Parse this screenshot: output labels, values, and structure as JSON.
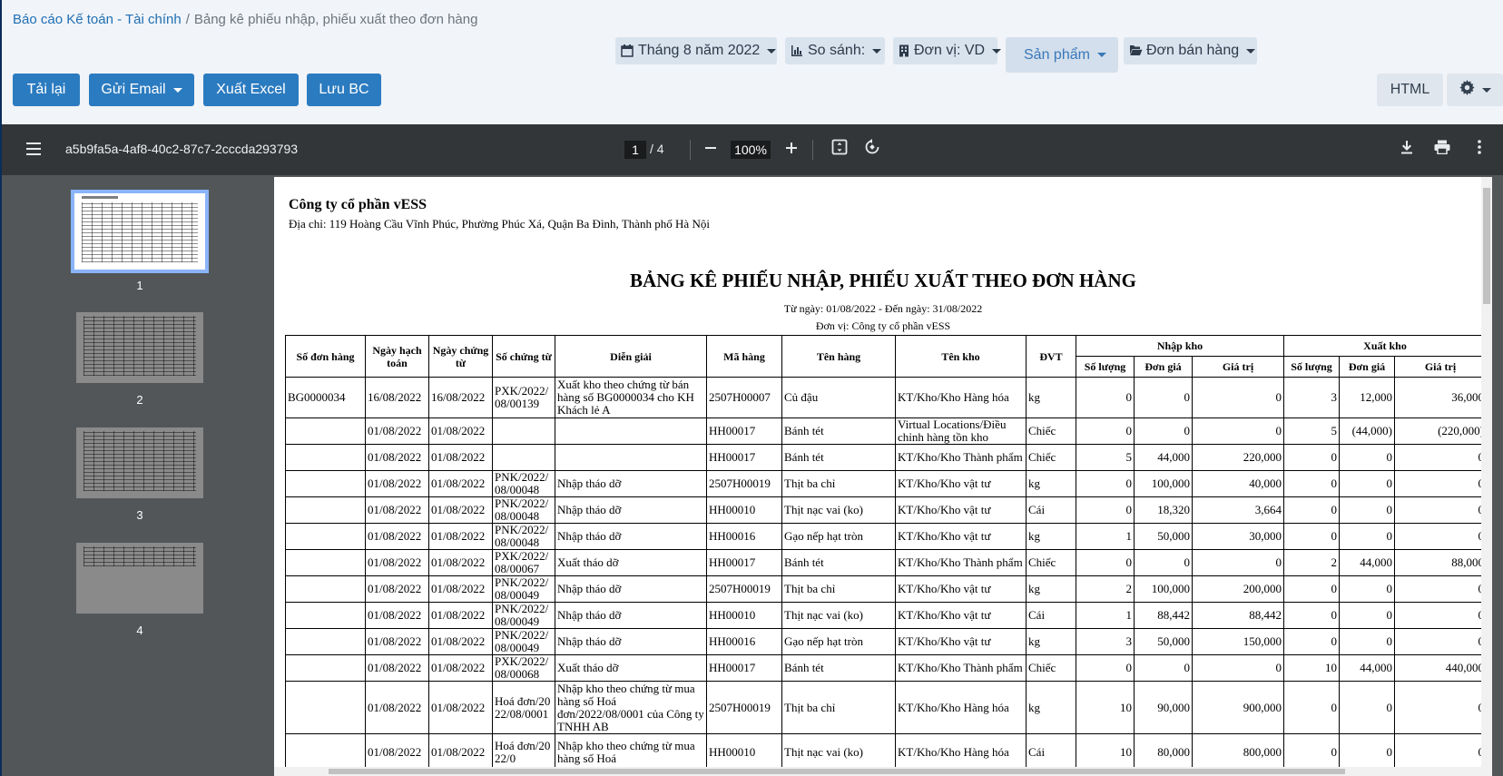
{
  "breadcrumb": {
    "parent": "Báo cáo Kế toán - Tài chính",
    "separator": "/",
    "current": "Bảng kê phiếu nhập, phiếu xuất theo đơn hàng"
  },
  "filters": {
    "period": "Tháng 8 năm 2022",
    "compare": "So sánh:",
    "unit": "Đơn vị: VD",
    "product": "Sản phẩm",
    "order_type": "Đơn bán hàng"
  },
  "toolbar": {
    "reload": "Tải lại",
    "email": "Gửi Email",
    "excel": "Xuất Excel",
    "save": "Lưu BC",
    "html": "HTML"
  },
  "viewer": {
    "doc_title": "a5b9fa5a-4af8-40c2-87c7-2cccda293793",
    "page_current": "1",
    "page_total": "/ 4",
    "zoom": "100%",
    "thumbnails": [
      "1",
      "2",
      "3",
      "4"
    ]
  },
  "report": {
    "company": "Công ty cổ phần vESS",
    "address": "Địa chỉ: 119 Hoàng Cầu Vĩnh Phúc, Phường Phúc Xá, Quận Ba Đình, Thành phố Hà Nội",
    "title": "BẢNG KÊ PHIẾU NHẬP, PHIẾU XUẤT THEO ĐƠN HÀNG",
    "date_range": "Từ ngày: 01/08/2022 - Đến ngày: 31/08/2022",
    "unit": "Đơn vị: Công ty cổ phần vESS",
    "headers": {
      "order_no": "Số đơn hàng",
      "posting_date": "Ngày hạch toán",
      "voucher_date": "Ngày chứng từ",
      "voucher_no": "Số chứng từ",
      "description": "Diễn giải",
      "item_code": "Mã hàng",
      "item_name": "Tên hàng",
      "warehouse": "Tên kho",
      "uom": "ĐVT",
      "import_group": "Nhập kho",
      "export_group": "Xuất kho",
      "qty": "Số lượng",
      "price": "Đơn giá",
      "value": "Giá trị"
    },
    "rows": [
      {
        "c": [
          "BG0000034",
          "16/08/2022",
          "16/08/2022",
          "PXK/2022/08/00139",
          "Xuất kho theo chứng từ bán hàng số BG0000034 cho KH Khách lẻ A",
          "2507H00007",
          "Củ đậu",
          "KT/Kho/Kho Hàng hóa",
          "kg",
          "0",
          "0",
          "0",
          "3",
          "12,000",
          "36,000"
        ]
      },
      {
        "c": [
          "",
          "01/08/2022",
          "01/08/2022",
          "",
          "",
          "HH00017",
          "Bánh tét",
          "Virtual Locations/Điều chỉnh hàng tồn kho",
          "Chiếc",
          "0",
          "0",
          "0",
          "5",
          "(44,000)",
          "(220,000)"
        ]
      },
      {
        "c": [
          "",
          "01/08/2022",
          "01/08/2022",
          "",
          "",
          "HH00017",
          "Bánh tét",
          "KT/Kho/Kho Thành phẩm",
          "Chiếc",
          "5",
          "44,000",
          "220,000",
          "0",
          "0",
          "0"
        ]
      },
      {
        "c": [
          "",
          "01/08/2022",
          "01/08/2022",
          "PNK/2022/08/00048",
          "Nhập tháo dỡ",
          "2507H00019",
          "Thịt ba chỉ",
          "KT/Kho/Kho vật tư",
          "kg",
          "0",
          "100,000",
          "40,000",
          "0",
          "0",
          "0"
        ]
      },
      {
        "c": [
          "",
          "01/08/2022",
          "01/08/2022",
          "PNK/2022/08/00048",
          "Nhập tháo dỡ",
          "HH00010",
          "Thịt nạc vai (ko)",
          "KT/Kho/Kho vật tư",
          "Cái",
          "0",
          "18,320",
          "3,664",
          "0",
          "0",
          "0"
        ]
      },
      {
        "c": [
          "",
          "01/08/2022",
          "01/08/2022",
          "PNK/2022/08/00048",
          "Nhập tháo dỡ",
          "HH00016",
          "Gạo nếp hạt tròn",
          "KT/Kho/Kho vật tư",
          "kg",
          "1",
          "50,000",
          "30,000",
          "0",
          "0",
          "0"
        ]
      },
      {
        "c": [
          "",
          "01/08/2022",
          "01/08/2022",
          "PXK/2022/08/00067",
          "Xuất tháo dỡ",
          "HH00017",
          "Bánh tét",
          "KT/Kho/Kho Thành phẩm",
          "Chiếc",
          "0",
          "0",
          "0",
          "2",
          "44,000",
          "88,000"
        ]
      },
      {
        "c": [
          "",
          "01/08/2022",
          "01/08/2022",
          "PNK/2022/08/00049",
          "Nhập tháo dỡ",
          "2507H00019",
          "Thịt ba chỉ",
          "KT/Kho/Kho vật tư",
          "kg",
          "2",
          "100,000",
          "200,000",
          "0",
          "0",
          "0"
        ]
      },
      {
        "c": [
          "",
          "01/08/2022",
          "01/08/2022",
          "PNK/2022/08/00049",
          "Nhập tháo dỡ",
          "HH00010",
          "Thịt nạc vai (ko)",
          "KT/Kho/Kho vật tư",
          "Cái",
          "1",
          "88,442",
          "88,442",
          "0",
          "0",
          "0"
        ]
      },
      {
        "c": [
          "",
          "01/08/2022",
          "01/08/2022",
          "PNK/2022/08/00049",
          "Nhập tháo dỡ",
          "HH00016",
          "Gạo nếp hạt tròn",
          "KT/Kho/Kho vật tư",
          "kg",
          "3",
          "50,000",
          "150,000",
          "0",
          "0",
          "0"
        ]
      },
      {
        "c": [
          "",
          "01/08/2022",
          "01/08/2022",
          "PXK/2022/08/00068",
          "Xuất tháo dỡ",
          "HH00017",
          "Bánh tét",
          "KT/Kho/Kho Thành phẩm",
          "Chiếc",
          "0",
          "0",
          "0",
          "10",
          "44,000",
          "440,000"
        ]
      },
      {
        "c": [
          "",
          "01/08/2022",
          "01/08/2022",
          "Hoá đơn/2022/08/0001",
          "Nhập kho theo chứng từ mua hàng số Hoá đơn/2022/08/0001 của Công ty TNHH AB",
          "2507H00019",
          "Thịt ba chỉ",
          "KT/Kho/Kho Hàng hóa",
          "kg",
          "10",
          "90,000",
          "900,000",
          "0",
          "0",
          "0"
        ]
      },
      {
        "c": [
          "",
          "01/08/2022",
          "01/08/2022",
          "Hoá đơn/2022/0",
          "Nhập kho theo chứng từ mua hàng số Hoá",
          "HH00010",
          "Thịt nạc vai (ko)",
          "KT/Kho/Kho Hàng hóa",
          "Cái",
          "10",
          "80,000",
          "800,000",
          "0",
          "0",
          "0"
        ]
      }
    ]
  }
}
